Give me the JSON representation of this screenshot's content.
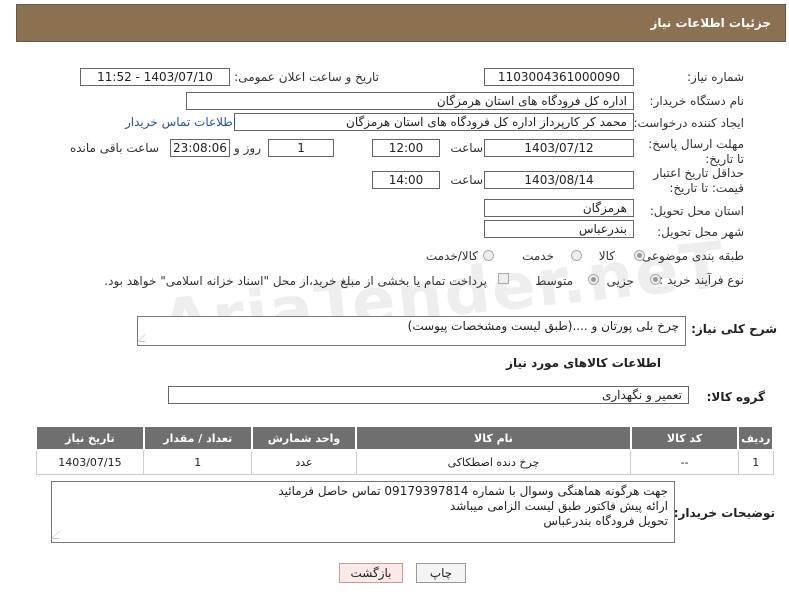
{
  "header": {
    "title": "جزئیات اطلاعات نیاز"
  },
  "form": {
    "need_number_label": "شماره نیاز:",
    "need_number": "1103004361000090",
    "announce_label": "تاریخ و ساعت اعلان عمومی:",
    "announce_value": "1403/07/10 - 11:52",
    "buyer_org_label": "نام دستگاه خریدار:",
    "buyer_org": "اداره کل فرودگاه های استان هرمزگان",
    "requester_label": "ایجاد کننده درخواست:",
    "requester": "محمد کر کارپرداز اداره کل فرودگاه های استان هرمزگان",
    "buyer_contact_link": "اطلاعات تماس خریدار",
    "deadline_label": "مهلت ارسال پاسخ: تا تاریخ:",
    "deadline_date": "1403/07/12",
    "time_label": "ساعت",
    "deadline_time": "12:00",
    "days_value": "1",
    "days_label": "روز و",
    "remaining_time": "23:08:06",
    "remaining_label": "ساعت باقی مانده",
    "validity_label": "حداقل تاریخ اعتبار قیمت: تا تاریخ:",
    "validity_date": "1403/08/14",
    "validity_time_label": "ساعت",
    "validity_time": "14:00",
    "province_label": "استان محل تحویل:",
    "province": "هرمزگان",
    "city_label": "شهر محل تحویل:",
    "city": "بندرعباس",
    "category_label": "طبقه بندی موضوعی:",
    "category_options": [
      "کالا",
      "خدمت",
      "کالا/خدمت"
    ],
    "process_label": "نوع فرآیند خرید :",
    "process_options": [
      "جزیی",
      "متوسط"
    ],
    "payment_note": "پرداخت تمام یا بخشی از مبلغ خرید،از محل \"اسناد خزانه اسلامی\" خواهد بود."
  },
  "description": {
    "label": "شرح کلی نیاز:",
    "text": "چرخ بلی پورتان و ....(طبق لیست ومشخصات پیوست)"
  },
  "goods": {
    "section_title": "اطلاعات کالاهای مورد نیاز",
    "group_label": "گروه کالا:",
    "group_value": "تعمیر و نگهداری",
    "columns": [
      "ردیف",
      "کد کالا",
      "نام کالا",
      "واحد شمارش",
      "تعداد / مقدار",
      "تاریخ نیاز"
    ],
    "rows": [
      [
        "1",
        "--",
        "چرخ دنده اصطکاکی",
        "عدد",
        "1",
        "1403/07/15"
      ]
    ]
  },
  "buyer_notes": {
    "label": "توضیحات خریدار:",
    "lines": [
      "جهت هرگونه هماهنگی وسوال با شماره 09179397814 تماس حاصل فرمائید",
      "ارائه پیش فاکتور طبق لیست الزامی میباشد",
      "تحویل فرودگاه بندرعباس"
    ]
  },
  "buttons": {
    "print": "چاپ",
    "back": "بازگشت"
  },
  "watermark": "AriaTender.neT",
  "colors": {
    "header_bg": "#8b7152",
    "table_header_bg": "#6f6f6f",
    "link": "#2255aa",
    "back_btn_bg": "#fde8e8"
  }
}
